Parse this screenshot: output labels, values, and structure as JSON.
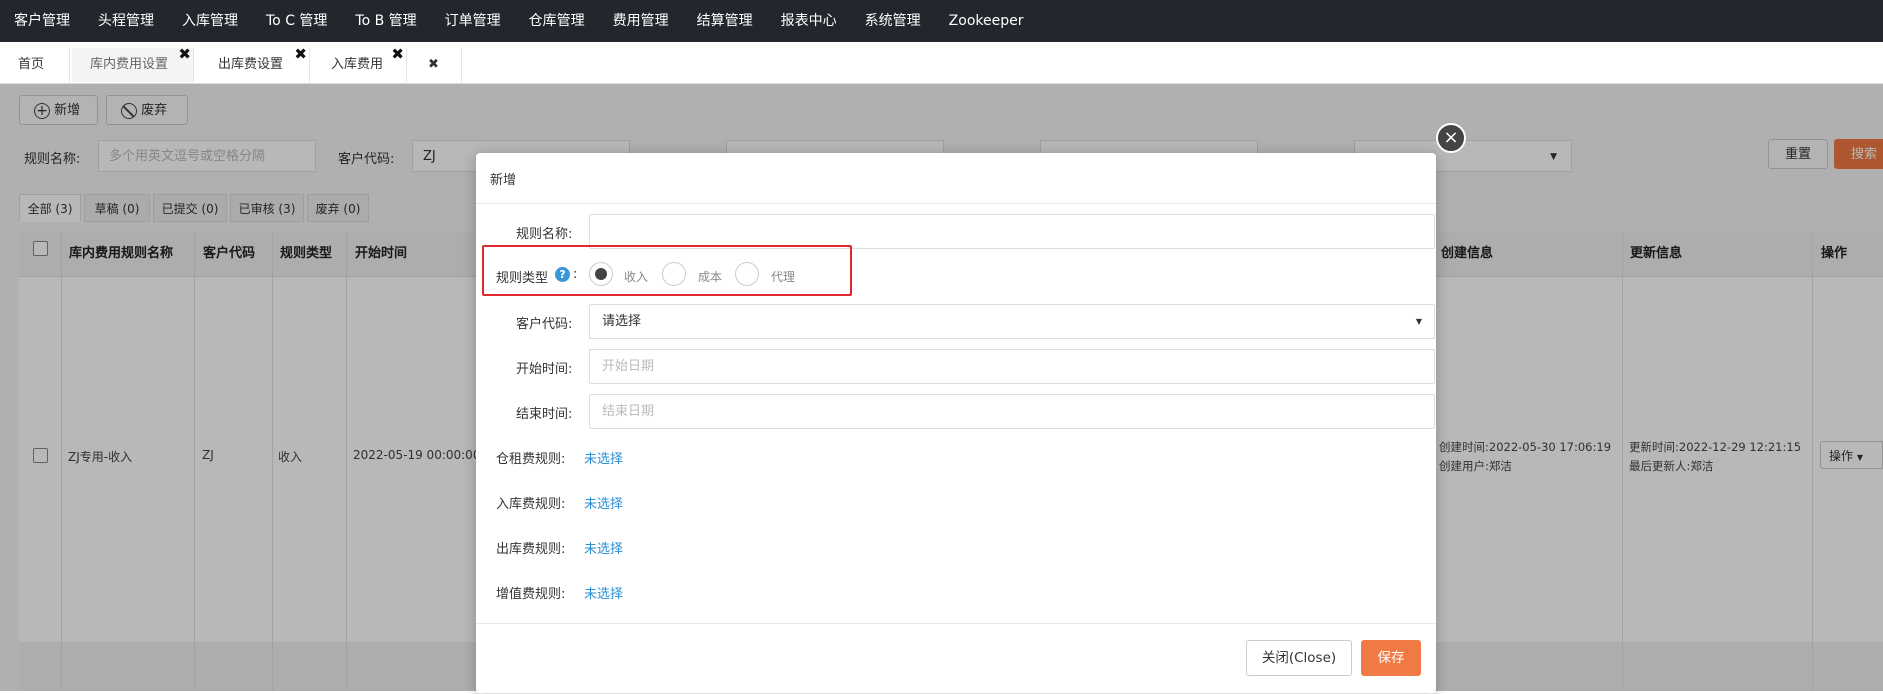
{
  "nav": {
    "items": [
      "客户管理",
      "头程管理",
      "入库管理",
      "To C 管理",
      "To B 管理",
      "订单管理",
      "仓库管理",
      "费用管理",
      "结算管理",
      "报表中心",
      "系统管理",
      "Zookeeper"
    ]
  },
  "tabs": {
    "home": "首页",
    "t1": "库内费用设置",
    "t2": "出库费设置",
    "t3": "入库费用",
    "close_glyph": "✖"
  },
  "toolbar": {
    "add": "新增",
    "discard": "废弃"
  },
  "filters": {
    "rule_name_label": "规则名称:",
    "rule_name_placeholder": "多个用英文逗号或空格分隔",
    "customer_label": "客户代码:",
    "customer_value": "ZJ",
    "reset": "重置",
    "search": "搜索"
  },
  "status_tabs": [
    "全部 (3)",
    "草稿 (0)",
    "已提交 (0)",
    "已审核 (3)",
    "废弃 (0)"
  ],
  "table": {
    "headers": {
      "name": "库内费用规则名称",
      "customer": "客户代码",
      "type": "规则类型",
      "start": "开始时间",
      "created": "创建信息",
      "updated": "更新信息",
      "ops": "操作"
    },
    "row": {
      "name": "ZJ专用-收入",
      "customer": "ZJ",
      "type": "收入",
      "start": "2022-05-19 00:00:00",
      "created_time": "创建时间:2022-05-30 17:06:19",
      "created_user": "创建用户:郑洁",
      "updated_time": "更新时间:2022-12-29 12:21:15",
      "updated_user": "最后更新人:郑洁",
      "ops_button": "操作"
    }
  },
  "modal": {
    "title": "新增",
    "rule_name_label": "规则名称:",
    "rule_type_label": "规则类型",
    "rule_type_colon": ":",
    "options": [
      "收入",
      "成本",
      "代理"
    ],
    "selected_option": "收入",
    "customer_label": "客户代码:",
    "customer_value": "请选择",
    "start_label": "开始时间:",
    "start_placeholder": "开始日期",
    "end_label": "结束时间:",
    "end_placeholder": "结束日期",
    "storage_label": "仓租费规则:",
    "inbound_label": "入库费规则:",
    "outbound_label": "出库费规则:",
    "vas_label": "增值费规则:",
    "unselected": "未选择",
    "close_btn": "关闭(Close)",
    "save_btn": "保存"
  },
  "colors": {
    "accent": "#f07a44",
    "link": "#2a8fd4",
    "highlight": "#e0282c",
    "nav_bg": "#22272d"
  }
}
